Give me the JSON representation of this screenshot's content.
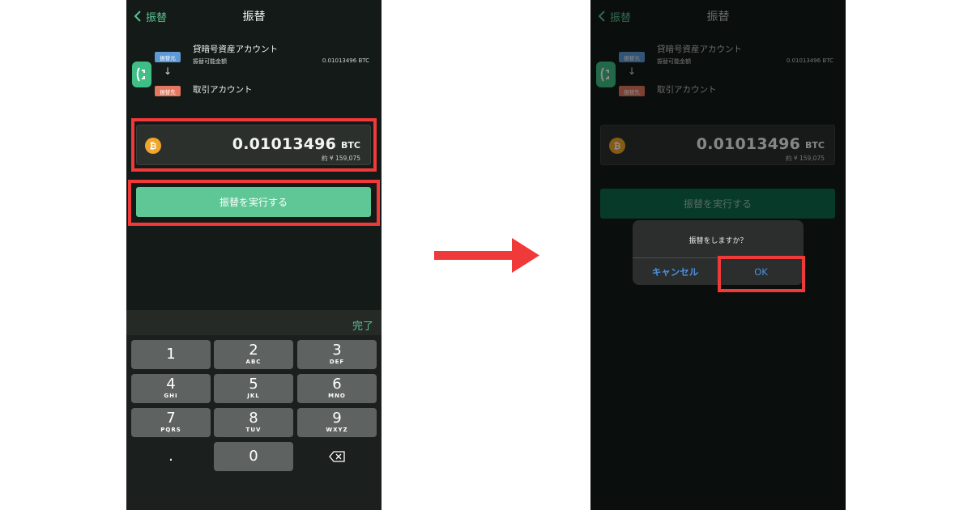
{
  "colors": {
    "accent_green": "#5ec795",
    "highlight_red": "#f03a3a",
    "ios_blue": "#4a90e2",
    "bitcoin_orange": "#f0a52b",
    "badge_from": "#5f9ad6",
    "badge_to": "#e3775f"
  },
  "left_screen": {
    "nav": {
      "back_label": "振替",
      "title": "振替"
    },
    "transfer": {
      "from_badge": "振替元",
      "to_badge": "振替先",
      "from_account": "貸暗号資産アカウント",
      "available_label": "振替可能金額",
      "available_amount": "0.01013496  BTC",
      "to_account": "取引アカウント"
    },
    "amount": {
      "value": "0.01013496",
      "unit": "BTC",
      "yen": "約 ¥ 159,075",
      "coin_symbol": "₿"
    },
    "execute_button": "振替を実行する",
    "keyboard": {
      "done": "完了",
      "keys": [
        {
          "num": "1",
          "letters": ""
        },
        {
          "num": "2",
          "letters": "ABC"
        },
        {
          "num": "3",
          "letters": "DEF"
        },
        {
          "num": "4",
          "letters": "GHI"
        },
        {
          "num": "5",
          "letters": "JKL"
        },
        {
          "num": "6",
          "letters": "MNO"
        },
        {
          "num": "7",
          "letters": "PQRS"
        },
        {
          "num": "8",
          "letters": "TUV"
        },
        {
          "num": "9",
          "letters": "WXYZ"
        }
      ],
      "dot": ".",
      "zero": "0",
      "delete_icon": "backspace-icon"
    }
  },
  "right_screen": {
    "nav": {
      "back_label": "振替",
      "title": "振替"
    },
    "transfer": {
      "from_badge": "振替元",
      "to_badge": "振替先",
      "from_account": "貸暗号資産アカウント",
      "available_label": "振替可能金額",
      "available_amount": "0.01013496  BTC",
      "to_account": "取引アカウント"
    },
    "amount": {
      "value": "0.01013496",
      "unit": "BTC",
      "yen": "約 ¥ 159,075",
      "coin_symbol": "₿"
    },
    "execute_button": "振替を実行する",
    "alert": {
      "message": "振替をしますか？",
      "cancel": "キャンセル",
      "ok": "OK"
    }
  }
}
